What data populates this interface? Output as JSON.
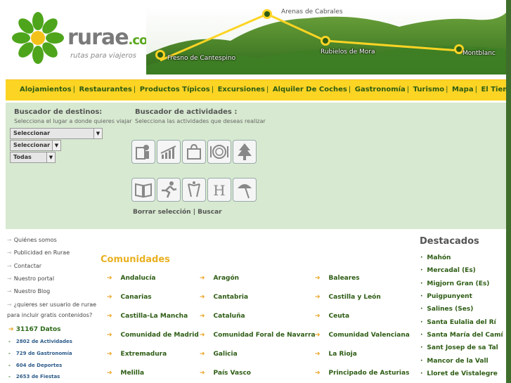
{
  "header": {
    "brand": "rurae",
    "brand_suffix": ".com",
    "tagline": "rutas para viajeros",
    "route_places": [
      "Arenas de Cabrales",
      "Fresno de Cantespino",
      "Rubielos de Mora",
      "Montblanc"
    ]
  },
  "nav": {
    "items": [
      "Alojamientos",
      "Restaurantes",
      "Productos Típicos",
      "Excursiones",
      "Alquiler De Coches",
      "Gastronomía",
      "Turismo",
      "Mapa",
      "El Tiempo"
    ]
  },
  "search": {
    "dest_title": "Buscador de destinos:",
    "dest_sub": "Selecciona el lugar a donde quieres viajar",
    "select1": "Seleccionar",
    "select2": "Seleccionar",
    "select3": "Todas",
    "act_title": "Buscador de actividades :",
    "act_sub": "Selecciona las actividades que deseas realizar",
    "clear": "Borrar selección",
    "search": "Buscar"
  },
  "left": {
    "links": [
      "Quiénes somos",
      "Publicidad en Rurae",
      "Contactar",
      "Nuestro portal",
      "Nuestro Blog",
      "¿quieres ser usuario de rurae",
      "para incluir gratis contenidos?"
    ],
    "datos": "31167 Datos",
    "stats": [
      "2802 de Actividades",
      "729 de Gastronomía",
      "604 de Deportes",
      "2653 de Fiestas"
    ]
  },
  "center": {
    "title": "Comunidades",
    "regions": [
      [
        "Andalucía",
        "Aragón",
        "Baleares"
      ],
      [
        "Canarias",
        "Cantabria",
        "Castilla y León"
      ],
      [
        "Castilla-La Mancha",
        "Cataluña",
        "Ceuta"
      ],
      [
        "Comunidad de Madrid",
        "Comunidad Foral de Navarra",
        "Comunidad Valenciana"
      ],
      [
        "Extremadura",
        "Galicia",
        "La Rioja"
      ],
      [
        "Melilla",
        "País Vasco",
        "Principado de Asturias"
      ]
    ]
  },
  "right": {
    "title": "Destacados",
    "items": [
      "Mahón",
      "Mercadal (Es)",
      "Migjorn Gran (Es)",
      "Puigpunyent",
      "Salines (Ses)",
      "Santa Eulalia del Rí",
      "Santa María del Camí",
      "Sant Josep de sa Tal",
      "Mancor de la Vall",
      "Lloret de Vistalegre"
    ]
  },
  "colors": {
    "brand_green": "#5aa81f",
    "nav_yellow": "#fcd424",
    "search_bg": "#d7e9d0",
    "link_green": "#2d5c14",
    "accent_orange": "#e9a21f"
  }
}
